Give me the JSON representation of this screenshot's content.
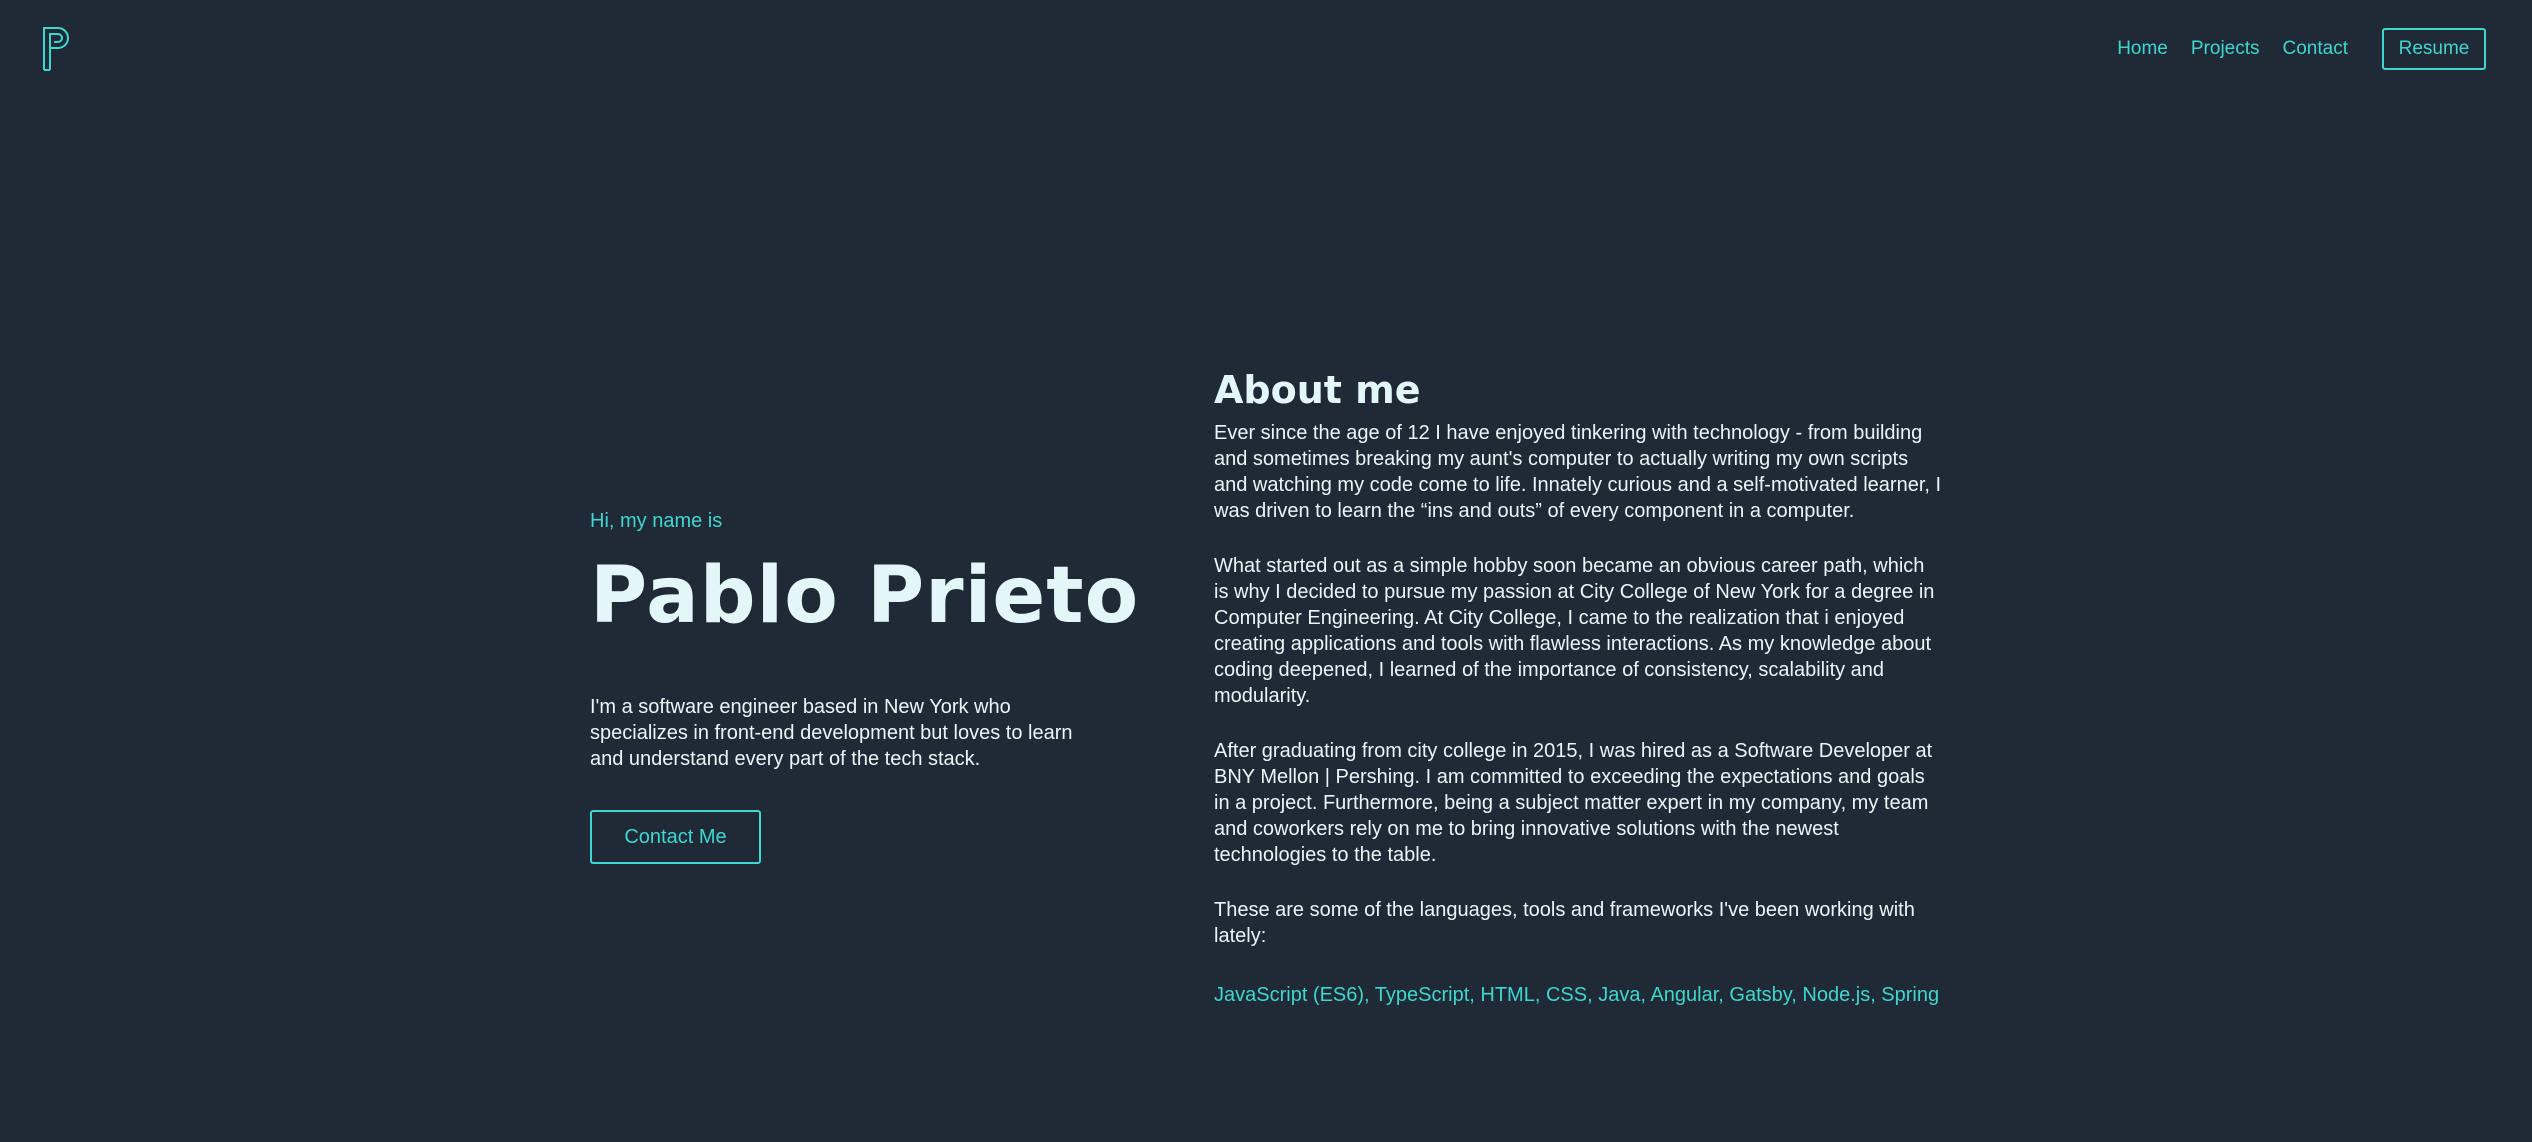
{
  "colors": {
    "background": "#202a36",
    "accent": "#3fd6cf",
    "text": "#e8f6f8"
  },
  "nav": {
    "logo_icon": "p-monogram-icon",
    "links": [
      "Home",
      "Projects",
      "Contact"
    ],
    "resume_label": "Resume"
  },
  "intro": {
    "greeting": "Hi, my name is",
    "name": "Pablo Prieto",
    "bio": "I'm a software engineer based in New York who specializes in front-end development but loves to learn and understand every part of the tech stack.",
    "contact_label": "Contact Me"
  },
  "about": {
    "title": "About me",
    "paragraphs": [
      "Ever since the age of 12 I have enjoyed tinkering with technology - from building and sometimes breaking my aunt's computer to actually writing my own scripts and watching my code come to life. Innately curious and a self-motivated learner, I was driven to learn the “ins and outs” of every component in a computer.",
      "What started out as a simple hobby soon became an obvious career path, which is why I decided to pursue my passion at City College of New York for a degree in Computer Engineering. At City College, I came to the realization that i enjoyed creating applications and tools with flawless interactions. As my knowledge about coding deepened, I learned of the importance of consistency, scalability and modularity.",
      "After graduating from city college in 2015, I was hired as a Software Developer at BNY Mellon | Pershing. I am committed to exceeding the expectations and goals in a project. Furthermore, being a subject matter expert in my company, my team and coworkers rely on me to bring innovative solutions with the newest technologies to the table.",
      "These are some of the languages, tools and frameworks I've been working with lately:"
    ],
    "skills": "JavaScript (ES6), TypeScript, HTML, CSS, Java, Angular, Gatsby, Node.js, Spring"
  }
}
